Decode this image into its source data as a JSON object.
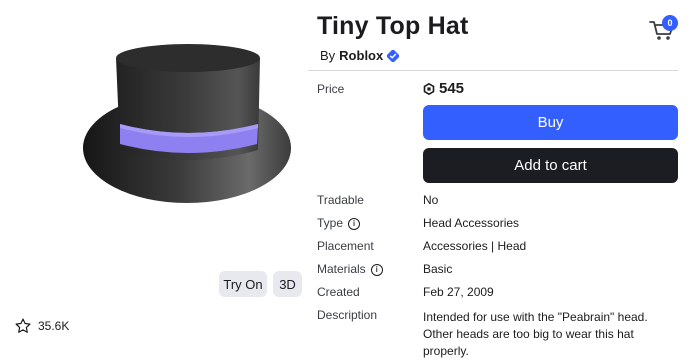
{
  "item": {
    "title": "Tiny Top Hat",
    "by_prefix": "By",
    "creator": "Roblox"
  },
  "cart": {
    "count": "0"
  },
  "preview": {
    "try_on_label": "Try On",
    "three_d_label": "3D",
    "favorites": "35.6K"
  },
  "price": {
    "label": "Price",
    "value": "545"
  },
  "actions": {
    "buy_label": "Buy",
    "add_to_cart_label": "Add to cart"
  },
  "details": {
    "tradable": {
      "label": "Tradable",
      "value": "No"
    },
    "type": {
      "label": "Type",
      "value": "Head Accessories"
    },
    "placement": {
      "label": "Placement",
      "value": "Accessories | Head"
    },
    "materials": {
      "label": "Materials",
      "value": "Basic"
    },
    "created": {
      "label": "Created",
      "value": "Feb 27, 2009"
    },
    "description": {
      "label": "Description",
      "value": "Intended for use with the \"Peabrain\" head. Other heads are too big to wear this hat properly."
    }
  },
  "colors": {
    "primary": "#335fff",
    "dark_button": "#1b1d23",
    "hat_band": "#8f80f2"
  }
}
